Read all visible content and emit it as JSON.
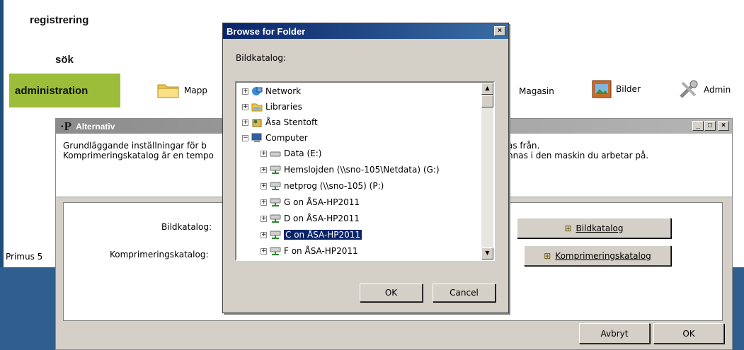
{
  "nav": {
    "registrering": "registrering",
    "sok": "sök",
    "administration": "administration"
  },
  "toolbar": {
    "mapp": "Mapp",
    "magasin": "Magasin",
    "bilder": "Bilder",
    "admin": "Admin"
  },
  "status": {
    "primus": "Primus 5"
  },
  "alternativ": {
    "title": "Alternativ",
    "desc_line1_left": "Grundläggande inställningar för b",
    "desc_line1_right": "as från.",
    "desc_line2_left": "Komprimeringskatalog är en tempo",
    "desc_line2_right": "nnas i den maskin du arbetar på.",
    "label_bildkatalog": "Bildkatalog:",
    "label_komprimering": "Komprimeringskatalog:",
    "btn_bildkatalog": "Bildkatalog",
    "btn_komprimering": "Komprimeringskatalog",
    "btn_avbryt": "Avbryt",
    "btn_ok": "OK"
  },
  "browse": {
    "title": "Browse for Folder",
    "prompt": "Bildkatalog:",
    "tree": [
      {
        "label": "Network",
        "icon": "network-icon"
      },
      {
        "label": "Libraries",
        "icon": "libraries-icon"
      },
      {
        "label": "Åsa Stentoft",
        "icon": "user-folder-icon"
      },
      {
        "label": "Computer",
        "icon": "computer-icon"
      },
      {
        "label": "Data (E:)",
        "icon": "drive-icon"
      },
      {
        "label": "Hemslojden (\\\\sno-105\\Netdata) (G:)",
        "icon": "network-drive-icon"
      },
      {
        "label": "netprog (\\\\sno-105) (P:)",
        "icon": "network-drive-icon"
      },
      {
        "label": "G on ÅSA-HP2011",
        "icon": "network-drive-icon"
      },
      {
        "label": "D on ÅSA-HP2011",
        "icon": "network-drive-icon"
      },
      {
        "label": "C on ÅSA-HP2011",
        "icon": "network-drive-icon",
        "selected": true
      },
      {
        "label": "F on ÅSA-HP2011",
        "icon": "network-drive-icon"
      }
    ],
    "ok": "OK",
    "cancel": "Cancel"
  },
  "colors": {
    "admin_tab": "#9cbd3a",
    "title_active": "#0a246a",
    "selection": "#0a246a",
    "band": "#305e8e",
    "arrow": "#e8452a"
  }
}
